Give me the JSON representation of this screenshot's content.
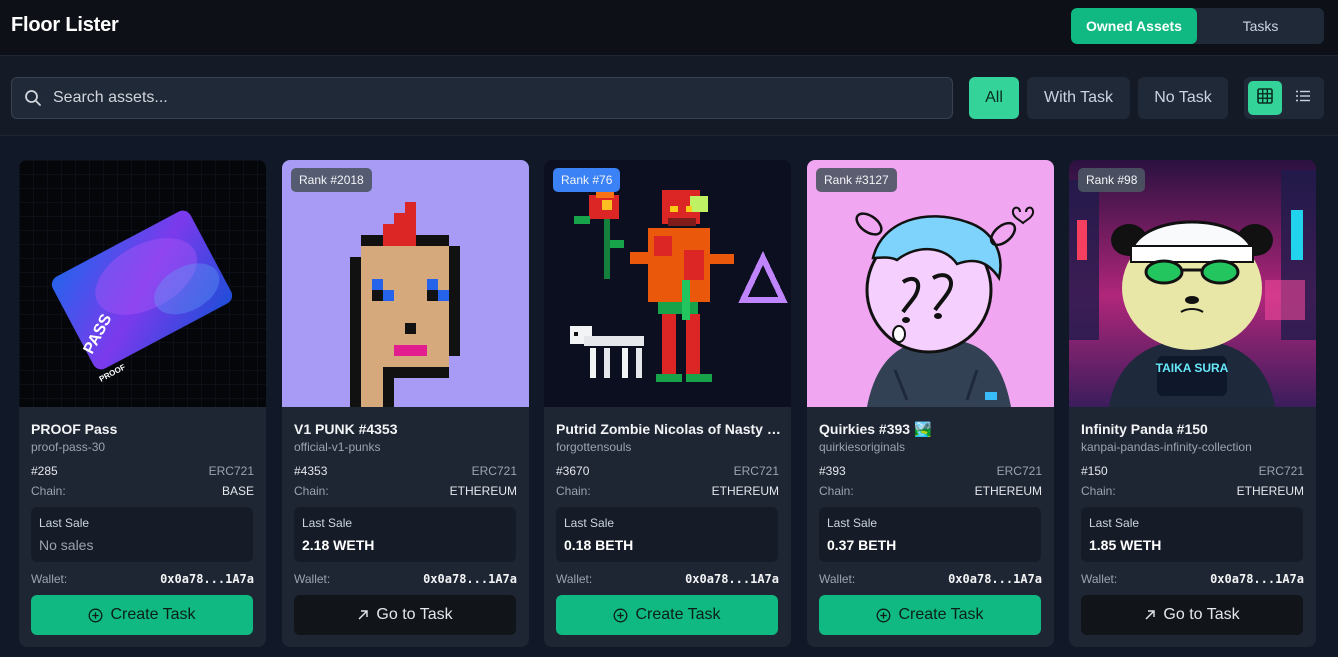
{
  "app": {
    "title": "Floor Lister"
  },
  "header_tabs": {
    "owned": "Owned Assets",
    "tasks": "Tasks"
  },
  "search": {
    "placeholder": "Search assets..."
  },
  "filters": {
    "all": "All",
    "with_task": "With Task",
    "no_task": "No Task"
  },
  "common": {
    "chain_label": "Chain:",
    "last_sale_label": "Last Sale",
    "wallet_label": "Wallet:"
  },
  "colors": {
    "accent": "#10b981",
    "accent_light": "#34d399",
    "rank_blue": "#3b82f6",
    "background": "#111827"
  },
  "cards": [
    {
      "name": "PROOF Pass",
      "collection": "proof-pass-30",
      "token_id": "#285",
      "standard": "ERC721",
      "chain": "BASE",
      "last_sale": "No sales",
      "wallet": "0x0a78...1A7a",
      "action": "Create Task",
      "action_icon": "plus-circle-icon",
      "image_text": "PASS",
      "image_brand": "PROOF"
    },
    {
      "name": "V1 PUNK #4353",
      "collection": "official-v1-punks",
      "rank": "Rank #2018",
      "token_id": "#4353",
      "standard": "ERC721",
      "chain": "ETHEREUM",
      "last_sale": "2.18 WETH",
      "wallet": "0x0a78...1A7a",
      "action": "Go to Task",
      "action_icon": "arrow-up-right-icon"
    },
    {
      "name": "Putrid Zombie Nicolas of Nasty Nightmares",
      "collection": "forgottensouls",
      "rank": "Rank #76",
      "token_id": "#3670",
      "standard": "ERC721",
      "chain": "ETHEREUM",
      "last_sale": "0.18 BETH",
      "wallet": "0x0a78...1A7a",
      "action": "Create Task",
      "action_icon": "plus-circle-icon"
    },
    {
      "name": "Quirkies #393 🏞️",
      "collection": "quirkiesoriginals",
      "rank": "Rank #3127",
      "token_id": "#393",
      "standard": "ERC721",
      "chain": "ETHEREUM",
      "last_sale": "0.37 BETH",
      "wallet": "0x0a78...1A7a",
      "action": "Create Task",
      "action_icon": "plus-circle-icon"
    },
    {
      "name": "Infinity Panda #150",
      "collection": "kanpai-pandas-infinity-collection",
      "rank": "Rank #98",
      "token_id": "#150",
      "standard": "ERC721",
      "chain": "ETHEREUM",
      "last_sale": "1.85 WETH",
      "wallet": "0x0a78...1A7a",
      "action": "Go to Task",
      "action_icon": "arrow-up-right-icon",
      "image_text": "TAIKA SURA"
    }
  ]
}
